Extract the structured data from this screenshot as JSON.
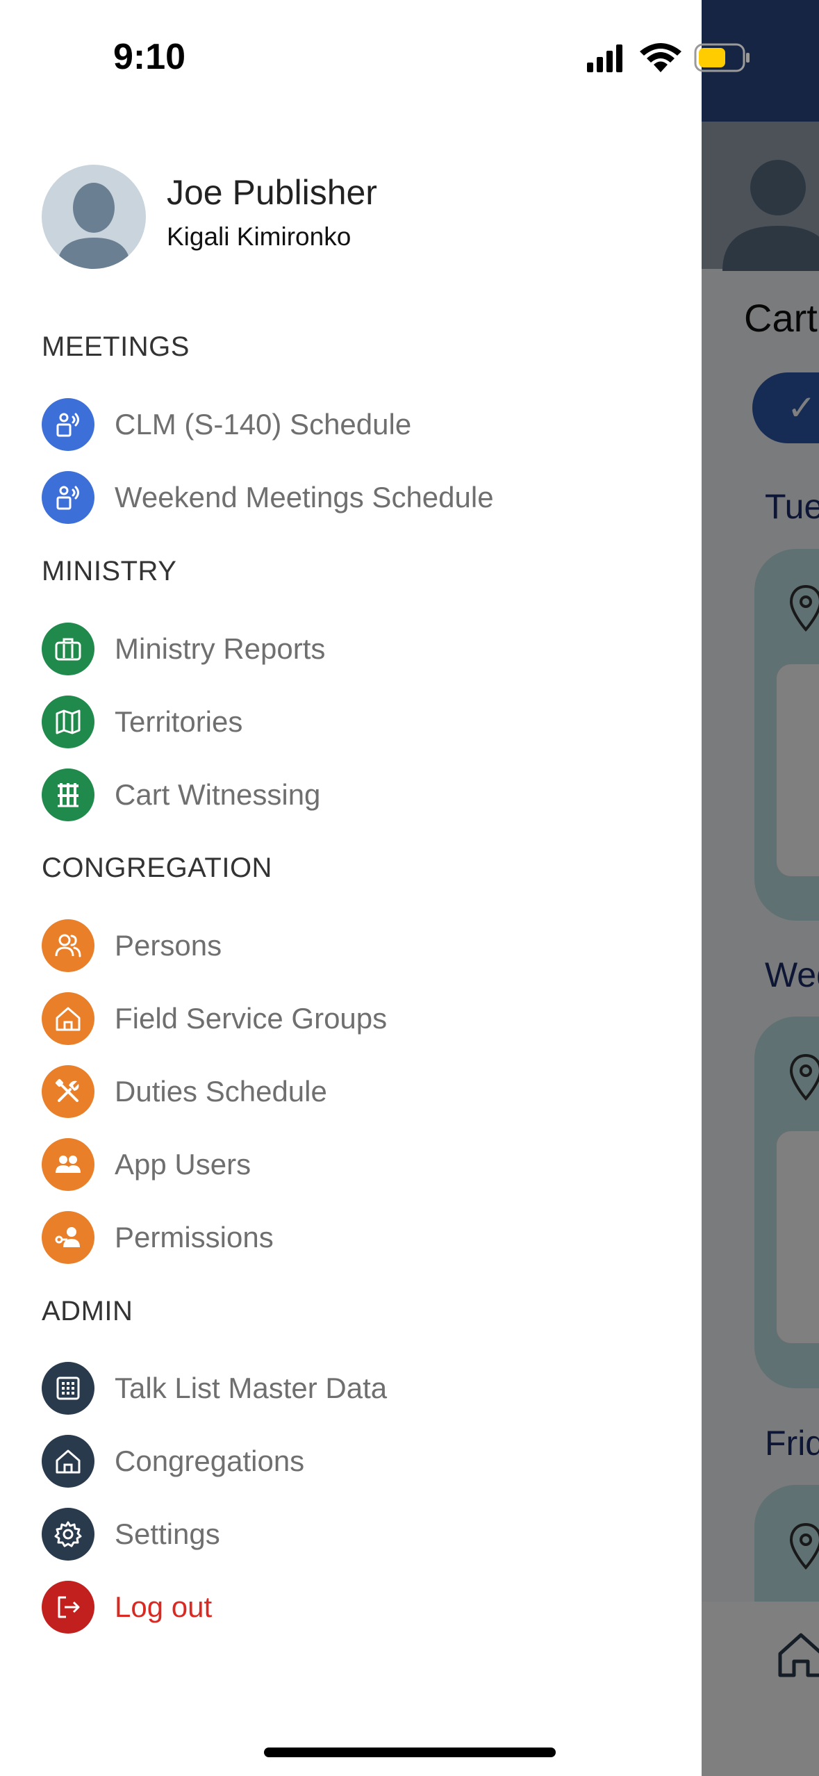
{
  "status_bar": {
    "time": "9:10"
  },
  "profile": {
    "name": "Joe Publisher",
    "congregation": "Kigali Kimironko"
  },
  "menu": {
    "sections": [
      {
        "title": "MEETINGS",
        "items": [
          {
            "label": "CLM (S-140) Schedule",
            "icon": "podium-speaker-icon",
            "color": "#3d6fd8"
          },
          {
            "label": "Weekend Meetings Schedule",
            "icon": "podium-speaker-icon",
            "color": "#3d6fd8"
          }
        ]
      },
      {
        "title": "MINISTRY",
        "items": [
          {
            "label": "Ministry Reports",
            "icon": "briefcase-icon",
            "color": "#1f8a4b"
          },
          {
            "label": "Territories",
            "icon": "map-icon",
            "color": "#1f8a4b"
          },
          {
            "label": "Cart Witnessing",
            "icon": "cart-stand-icon",
            "color": "#1f8a4b"
          }
        ]
      },
      {
        "title": "CONGREGATION",
        "items": [
          {
            "label": "Persons",
            "icon": "people-outline-icon",
            "color": "#ea7f2a"
          },
          {
            "label": "Field Service Groups",
            "icon": "home-icon",
            "color": "#ea7f2a"
          },
          {
            "label": "Duties Schedule",
            "icon": "tools-icon",
            "color": "#ea7f2a"
          },
          {
            "label": "App Users",
            "icon": "users-icon",
            "color": "#ea7f2a"
          },
          {
            "label": "Permissions",
            "icon": "user-key-icon",
            "color": "#ea7f2a"
          }
        ]
      },
      {
        "title": "ADMIN",
        "items": [
          {
            "label": "Talk List Master Data",
            "icon": "grid-icon",
            "color": "#2a3a4d"
          },
          {
            "label": "Congregations",
            "icon": "home-icon",
            "color": "#2a3a4d"
          },
          {
            "label": "Settings",
            "icon": "gear-icon",
            "color": "#2a3a4d"
          },
          {
            "label": "Log out",
            "icon": "logout-icon",
            "color": "#c1201e",
            "text_color": "#d82a22"
          }
        ]
      }
    ]
  },
  "background_screen": {
    "title": "Cart",
    "days": [
      "Tue",
      "Wed",
      "Frid"
    ]
  }
}
